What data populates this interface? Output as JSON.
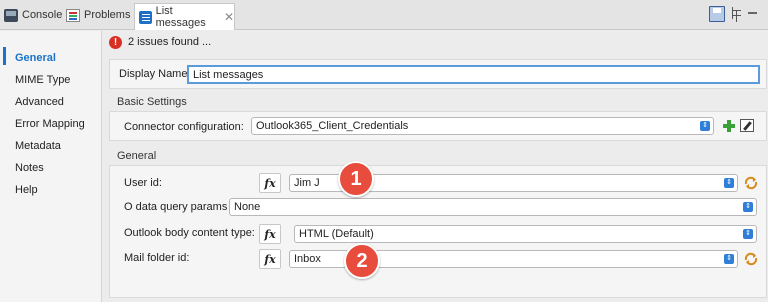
{
  "tabs": [
    {
      "label": "Console",
      "icon": "console-icon"
    },
    {
      "label": "Problems",
      "icon": "problems-icon"
    },
    {
      "label": "List messages",
      "icon": "list-messages-icon",
      "close": "✕"
    }
  ],
  "nav": {
    "items": [
      "General",
      "MIME Type",
      "Advanced",
      "Error Mapping",
      "Metadata",
      "Notes",
      "Help"
    ],
    "active": "General",
    "accent": "#1a73c9"
  },
  "issues": {
    "icon": "!",
    "text": "2 issues found ..."
  },
  "display_name": {
    "label": "Display Name:",
    "value": "List messages"
  },
  "basic": {
    "title": "Basic Settings",
    "connector_label": "Connector configuration:",
    "connector_value": "Outlook365_Client_Credentials"
  },
  "general": {
    "title": "General",
    "user_id_label": "User id:",
    "user_id_value": "Jim J",
    "odata_label": "O data query params",
    "odata_value": "None",
    "body_type_label": "Outlook body content type:",
    "body_type_value": "HTML (Default)",
    "mail_folder_label": "Mail folder id:",
    "mail_folder_value": "Inbox",
    "fx": "fx"
  },
  "badges": [
    "1",
    "2"
  ],
  "colors": {
    "badge": "#e74c3c",
    "error": "#d93025",
    "combo_arrow": "#2f7ed8"
  }
}
